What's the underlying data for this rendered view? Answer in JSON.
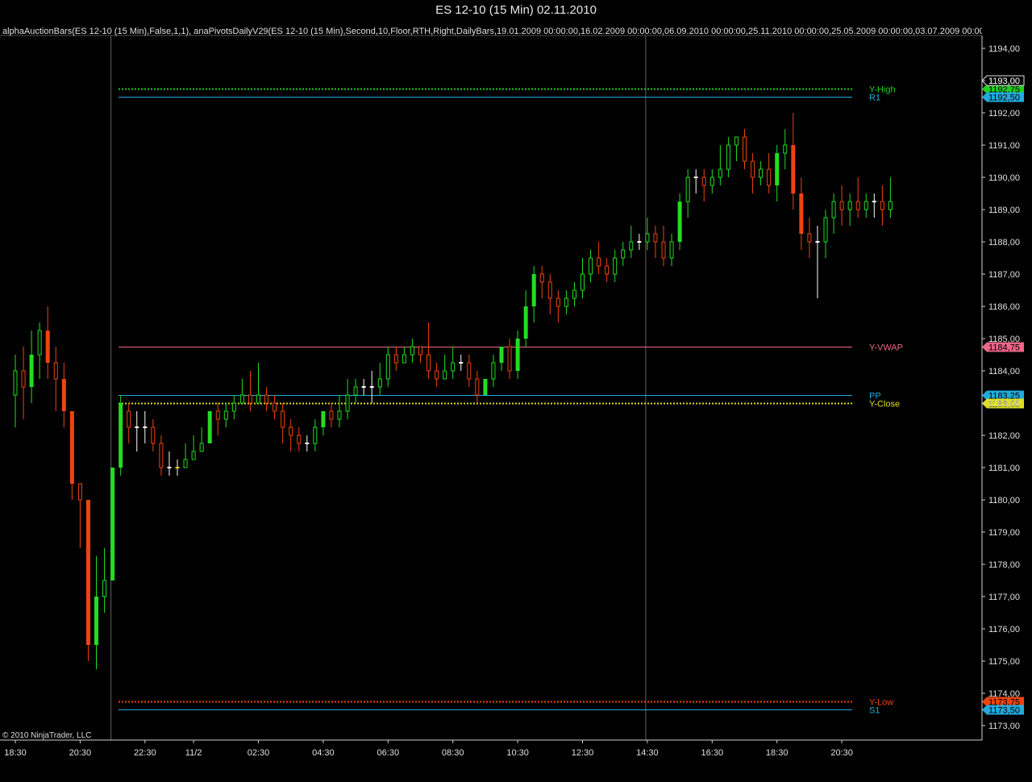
{
  "window": {
    "title": "ES 12-10 (15 Min)  02.11.2010"
  },
  "indicator_text": "alphaAuctionBars(ES 12-10 (15 Min),False,1,1),  anaPivotsDailyV29(ES 12-10 (15 Min),Second,10,Floor,RTH,Right,DailyBars,19.01.2009  00:00:00,16.02.2009  00:00:00,06.09.2010  00:00:00,25.11.2010  00:00:00,25.05.2009  00:00:00,03.07.2009  00:00",
  "copyright": "© 2010 NinjaTrader, LLC",
  "colors": {
    "background": "#000000",
    "up": "#22dd22",
    "down": "#ee4411",
    "doji": "#ffffff",
    "mid": "#ffcc00"
  },
  "chart_data": {
    "type": "candlestick",
    "ylim": [
      1172.6,
      1194.4
    ],
    "y_ticks": [
      "1173,00",
      "1174,00",
      "1175,00",
      "1176,00",
      "1177,00",
      "1178,00",
      "1179,00",
      "1180,00",
      "1181,00",
      "1182,00",
      "1183,00",
      "1184,00",
      "1185,00",
      "1186,00",
      "1187,00",
      "1188,00",
      "1189,00",
      "1190,00",
      "1191,00",
      "1192,00",
      "1193,00",
      "1194,00"
    ],
    "x_ticks": [
      "18:30",
      "20:30",
      "22:30",
      "11/2",
      "02:30",
      "04:30",
      "06:30",
      "08:30",
      "10:30",
      "12:30",
      "14:30",
      "16:30",
      "18:30",
      "20:30"
    ],
    "x_tick_bar_index": [
      0,
      8,
      16,
      22,
      30,
      38,
      46,
      54,
      62,
      70,
      78,
      86,
      94,
      102
    ],
    "session_dividers_bar_index": [
      12,
      78
    ],
    "levels": [
      {
        "name": "Y-High",
        "value": 1192.75,
        "price_label": "1192,75",
        "color": "#22cc22",
        "style": "dotted"
      },
      {
        "name": "R1",
        "value": 1192.5,
        "price_label": "1192,50",
        "color": "#22aadd",
        "style": "solid"
      },
      {
        "name": "Y-VWAP",
        "value": 1184.75,
        "price_label": "1184,75",
        "color": "#ee6688",
        "style": "solid"
      },
      {
        "name": "PP",
        "value": 1183.25,
        "price_label": "1183,25",
        "color": "#22aadd",
        "style": "solid"
      },
      {
        "name": "Y-Close",
        "value": 1183.0,
        "price_label": "1183,00",
        "color": "#dddd22",
        "style": "dotted"
      },
      {
        "name": "Y-Low",
        "value": 1173.75,
        "price_label": "1173,75",
        "color": "#ee4411",
        "style": "dotted"
      },
      {
        "name": "S1",
        "value": 1173.5,
        "price_label": "1173,50",
        "color": "#22aadd",
        "style": "solid"
      }
    ],
    "last_price": {
      "value": 1193.0,
      "label": "1193,00"
    },
    "bars": [
      [
        1183.25,
        1184.0,
        1184.5,
        1182.25
      ],
      [
        1184.0,
        1183.5,
        1184.75,
        1182.5
      ],
      [
        1183.5,
        1184.5,
        1185.25,
        1183.0
      ],
      [
        1184.5,
        1185.25,
        1185.5,
        1183.75
      ],
      [
        1185.25,
        1184.25,
        1186.0,
        1183.75
      ],
      [
        1184.25,
        1183.75,
        1184.75,
        1182.75
      ],
      [
        1183.75,
        1182.75,
        1184.25,
        1182.25
      ],
      [
        1182.75,
        1180.5,
        1182.75,
        1180.0
      ],
      [
        1180.5,
        1180.0,
        1180.5,
        1178.5
      ],
      [
        1180.0,
        1175.5,
        1180.0,
        1175.0
      ],
      [
        1175.5,
        1177.0,
        1178.25,
        1174.75
      ],
      [
        1177.0,
        1177.5,
        1178.5,
        1176.5
      ],
      [
        1177.5,
        1181.0,
        1181.0,
        1177.5
      ],
      [
        1181.0,
        1183.0,
        1183.25,
        1180.75
      ],
      [
        1182.75,
        1182.25,
        1183.0,
        1181.75
      ],
      [
        1182.25,
        1182.25,
        1182.75,
        1181.5
      ],
      [
        1182.25,
        1182.25,
        1182.75,
        1181.75
      ],
      [
        1182.25,
        1181.75,
        1182.5,
        1181.5
      ],
      [
        1181.75,
        1181.0,
        1182.0,
        1180.75
      ],
      [
        1181.0,
        1181.0,
        1181.5,
        1180.75
      ],
      [
        1181.0,
        1181.0,
        1181.25,
        1180.75
      ],
      [
        1181.0,
        1181.25,
        1181.75,
        1181.0
      ],
      [
        1181.25,
        1181.5,
        1182.0,
        1181.25
      ],
      [
        1181.5,
        1181.75,
        1182.25,
        1181.5
      ],
      [
        1181.75,
        1182.75,
        1182.75,
        1181.75
      ],
      [
        1182.75,
        1182.5,
        1183.0,
        1182.0
      ],
      [
        1182.5,
        1182.75,
        1183.0,
        1182.25
      ],
      [
        1182.75,
        1183.0,
        1183.25,
        1182.5
      ],
      [
        1183.0,
        1183.25,
        1183.75,
        1183.0
      ],
      [
        1183.25,
        1183.0,
        1184.0,
        1182.75
      ],
      [
        1183.0,
        1183.25,
        1184.25,
        1183.0
      ],
      [
        1183.25,
        1183.0,
        1183.5,
        1182.75
      ],
      [
        1183.0,
        1182.75,
        1183.25,
        1182.5
      ],
      [
        1182.75,
        1182.25,
        1183.0,
        1181.75
      ],
      [
        1182.25,
        1182.0,
        1182.5,
        1181.5
      ],
      [
        1182.0,
        1181.75,
        1182.25,
        1181.5
      ],
      [
        1181.75,
        1181.75,
        1182.0,
        1181.5
      ],
      [
        1181.75,
        1182.25,
        1182.5,
        1181.5
      ],
      [
        1182.25,
        1182.75,
        1182.75,
        1182.0
      ],
      [
        1182.75,
        1182.5,
        1183.0,
        1182.25
      ],
      [
        1182.5,
        1182.75,
        1183.25,
        1182.25
      ],
      [
        1182.75,
        1183.25,
        1183.75,
        1182.5
      ],
      [
        1183.25,
        1183.5,
        1183.75,
        1183.0
      ],
      [
        1183.5,
        1183.5,
        1183.75,
        1183.25
      ],
      [
        1183.5,
        1183.5,
        1184.0,
        1183.0
      ],
      [
        1183.5,
        1183.75,
        1184.25,
        1183.25
      ],
      [
        1183.75,
        1184.5,
        1184.75,
        1183.5
      ],
      [
        1184.5,
        1184.25,
        1184.75,
        1184.0
      ],
      [
        1184.25,
        1184.5,
        1184.75,
        1184.25
      ],
      [
        1184.5,
        1184.75,
        1185.0,
        1184.25
      ],
      [
        1184.75,
        1184.5,
        1184.75,
        1184.25
      ],
      [
        1184.5,
        1184.0,
        1185.5,
        1183.75
      ],
      [
        1184.0,
        1183.75,
        1184.25,
        1183.5
      ],
      [
        1183.75,
        1184.0,
        1184.5,
        1183.75
      ],
      [
        1184.0,
        1184.25,
        1184.75,
        1183.75
      ],
      [
        1184.25,
        1184.25,
        1184.5,
        1184.0
      ],
      [
        1184.25,
        1183.75,
        1184.5,
        1183.5
      ],
      [
        1183.75,
        1183.25,
        1184.0,
        1183.0
      ],
      [
        1183.25,
        1183.75,
        1183.75,
        1183.25
      ],
      [
        1183.75,
        1184.25,
        1184.5,
        1183.5
      ],
      [
        1184.25,
        1184.75,
        1184.75,
        1184.0
      ],
      [
        1184.75,
        1184.0,
        1185.0,
        1183.75
      ],
      [
        1184.0,
        1185.0,
        1185.25,
        1183.75
      ],
      [
        1185.0,
        1186.0,
        1186.5,
        1184.75
      ],
      [
        1186.0,
        1187.0,
        1187.25,
        1185.5
      ],
      [
        1187.0,
        1186.75,
        1187.25,
        1186.25
      ],
      [
        1186.75,
        1186.25,
        1187.0,
        1185.75
      ],
      [
        1186.25,
        1186.0,
        1186.5,
        1185.5
      ],
      [
        1186.0,
        1186.25,
        1186.5,
        1185.75
      ],
      [
        1186.25,
        1186.5,
        1186.75,
        1186.0
      ],
      [
        1186.5,
        1187.0,
        1187.5,
        1186.25
      ],
      [
        1187.0,
        1187.5,
        1187.75,
        1186.75
      ],
      [
        1187.5,
        1187.25,
        1188.0,
        1187.0
      ],
      [
        1187.25,
        1187.0,
        1187.5,
        1186.75
      ],
      [
        1187.0,
        1187.5,
        1187.75,
        1186.75
      ],
      [
        1187.5,
        1187.75,
        1188.0,
        1187.25
      ],
      [
        1187.75,
        1188.0,
        1188.5,
        1187.5
      ],
      [
        1188.0,
        1188.0,
        1188.25,
        1187.75
      ],
      [
        1188.0,
        1188.25,
        1188.75,
        1187.75
      ],
      [
        1188.25,
        1188.0,
        1188.5,
        1187.5
      ],
      [
        1188.0,
        1187.5,
        1188.5,
        1187.25
      ],
      [
        1187.5,
        1188.0,
        1188.25,
        1187.25
      ],
      [
        1188.0,
        1189.25,
        1189.5,
        1187.75
      ],
      [
        1189.25,
        1190.0,
        1190.25,
        1188.75
      ],
      [
        1190.0,
        1190.0,
        1190.25,
        1189.5
      ],
      [
        1190.0,
        1189.75,
        1190.25,
        1189.25
      ],
      [
        1189.75,
        1190.0,
        1190.25,
        1189.5
      ],
      [
        1190.0,
        1190.25,
        1191.0,
        1189.75
      ],
      [
        1190.25,
        1191.0,
        1191.25,
        1190.0
      ],
      [
        1191.0,
        1191.25,
        1191.25,
        1190.5
      ],
      [
        1191.25,
        1190.5,
        1191.5,
        1190.25
      ],
      [
        1190.5,
        1190.0,
        1190.75,
        1189.5
      ],
      [
        1190.0,
        1190.25,
        1190.5,
        1189.75
      ],
      [
        1190.25,
        1189.75,
        1190.75,
        1189.5
      ],
      [
        1189.75,
        1190.75,
        1191.0,
        1189.25
      ],
      [
        1190.75,
        1191.0,
        1191.5,
        1190.25
      ],
      [
        1191.0,
        1189.5,
        1192.0,
        1189.0
      ],
      [
        1189.5,
        1188.25,
        1190.0,
        1187.75
      ],
      [
        1188.25,
        1188.0,
        1188.75,
        1187.5
      ],
      [
        1188.0,
        1188.0,
        1188.5,
        1186.25
      ],
      [
        1188.0,
        1188.75,
        1189.0,
        1187.5
      ],
      [
        1188.75,
        1189.25,
        1189.5,
        1188.25
      ],
      [
        1189.25,
        1189.0,
        1189.75,
        1188.5
      ],
      [
        1189.0,
        1189.25,
        1189.5,
        1188.5
      ],
      [
        1189.25,
        1189.0,
        1190.0,
        1188.75
      ],
      [
        1189.0,
        1189.25,
        1189.5,
        1188.75
      ],
      [
        1189.25,
        1189.25,
        1189.5,
        1188.75
      ],
      [
        1189.25,
        1189.0,
        1189.75,
        1188.5
      ],
      [
        1189.0,
        1189.25,
        1190.0,
        1188.75
      ]
    ]
  }
}
